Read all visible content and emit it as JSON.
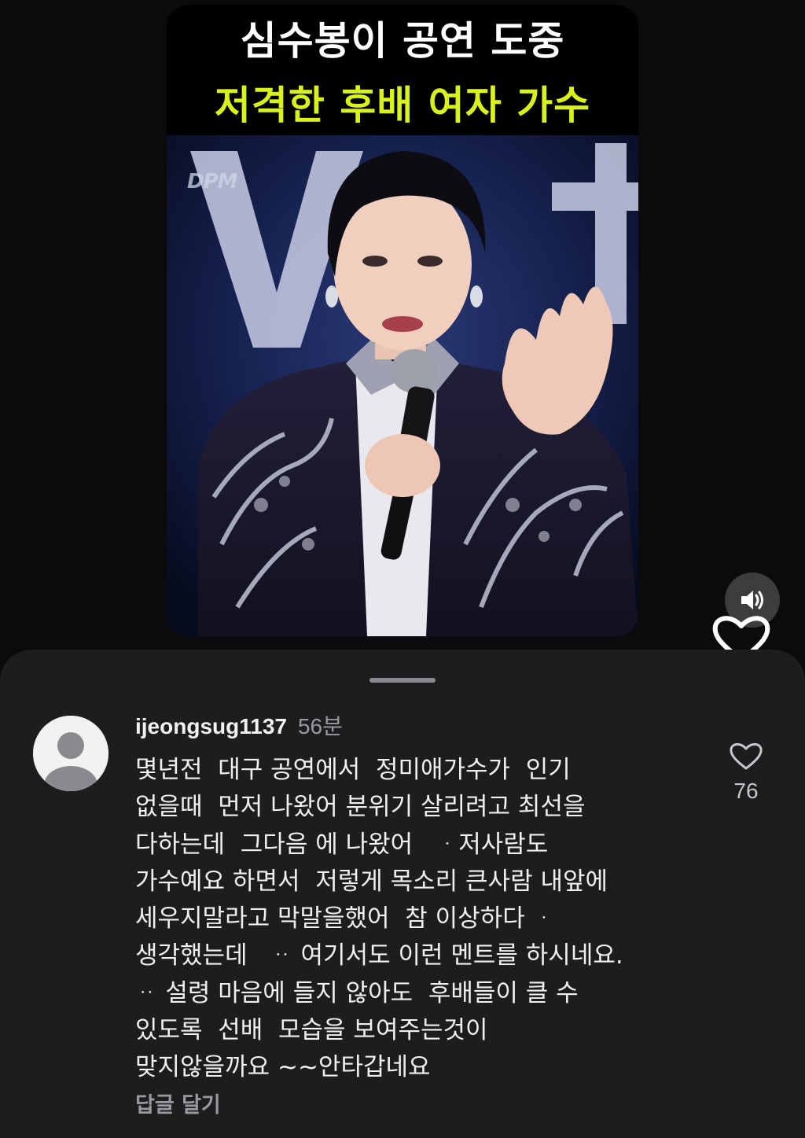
{
  "video": {
    "headline_line1": "심수봉이 공연 도중",
    "headline_line2": "저격한 후배 여자 가수",
    "watermark": "DPM",
    "colors": {
      "headline_line1": "#ffffff",
      "headline_line2": "#d9f21a"
    }
  },
  "controls": {
    "sound_icon": "speaker-icon",
    "like_icon": "heart-outline-icon"
  },
  "comment": {
    "avatar_icon": "default-avatar-icon",
    "username": "ijeongsug1137",
    "time_ago": "56분",
    "lines": [
      "몇년전  대구 공연에서  정미애가수가  인기",
      "없을때  먼저 나왔어 분위기 살리려고 최선을",
      "다하는데  그다음 에 나왔어   ᆞ저사람도",
      "가수예요 하면서  저렇게 목소리 큰사람 내앞에",
      "세우지말라고 막말을했어  참 이상하다 ᆞ",
      "생각했는데   ᆢ 여기서도 이런 멘트를 하시네요.",
      "ᆢ 설령 마음에 들지 않아도  후배들이 클 수",
      "있도록  선배  모습을 보여주는것이",
      "맞지않을까요 ~~안타갑네요"
    ],
    "reply_label": "답글 달기",
    "like_count": "76"
  }
}
